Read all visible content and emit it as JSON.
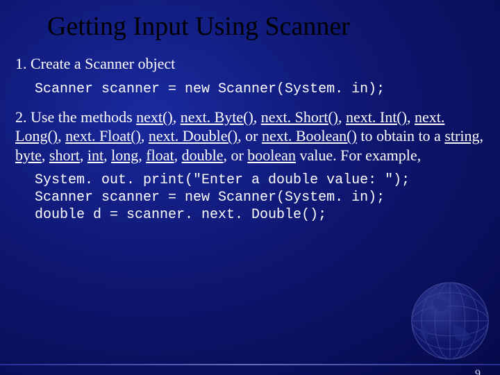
{
  "title": "Getting Input Using Scanner",
  "step1": {
    "label": "1. Create a Scanner object",
    "code": "Scanner scanner = new Scanner(System. in);"
  },
  "step2": {
    "prefix": "2. Use the methods ",
    "m1": "next()",
    "c1": ", ",
    "m2": "next. Byte()",
    "c2": ", ",
    "m3": "next. Short()",
    "c3": ", ",
    "m4": "next. Int()",
    "c4": ", ",
    "m5": "next. Long()",
    "c5": ", ",
    "m6": "next. Float()",
    "c6": ", ",
    "m7": "next. Double()",
    "c7": ", or ",
    "m8": "next. Boolean()",
    "mid": " to obtain to a ",
    "t1": "string",
    "d1": ", ",
    "t2": "byte",
    "d2": ", ",
    "t3": "short",
    "d3": ", ",
    "t4": "int",
    "d4": ", ",
    "t5": "long",
    "d5": ", ",
    "t6": "float",
    "d6": ", ",
    "t7": "double",
    "d7": ", or ",
    "t8": "boolean",
    "suffix": " value. For example,",
    "code": "System. out. print(\"Enter a double value: \");\nScanner scanner = new Scanner(System. in);\ndouble d = scanner. next. Double();"
  },
  "pagenum": "9"
}
